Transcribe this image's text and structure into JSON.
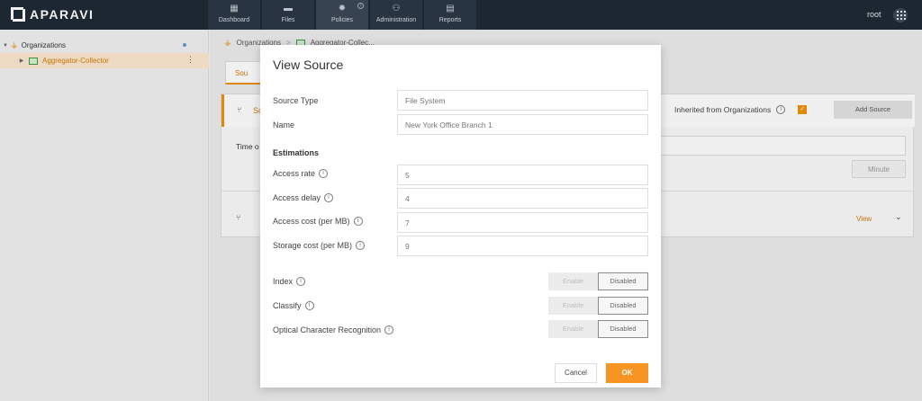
{
  "app": {
    "logo_text": "APARAVI"
  },
  "nav": {
    "items": [
      {
        "label": "Dashboard",
        "icon": "dashboard-icon"
      },
      {
        "label": "Files",
        "icon": "folder-icon"
      },
      {
        "label": "Policies",
        "icon": "gear-icon"
      },
      {
        "label": "Administration",
        "icon": "users-icon"
      },
      {
        "label": "Reports",
        "icon": "report-icon"
      }
    ],
    "active": "Policies",
    "policies_badge": "i"
  },
  "user": {
    "name": "root"
  },
  "tree": {
    "items": [
      {
        "label": "Organizations",
        "level": 0,
        "expanded": true
      },
      {
        "label": "Aggregator-Collector",
        "level": 1,
        "selected": true
      }
    ]
  },
  "breadcrumb": {
    "items": [
      "Organizations",
      "Aggregator-Collec..."
    ],
    "separator": ">"
  },
  "background": {
    "tab_label": "Sou",
    "panel_label": "So",
    "inherited_label": "Inherited from Organizations",
    "add_source_label": "Add Source",
    "time_label": "Time o",
    "minute_label": "Minute",
    "view_label": "View"
  },
  "modal": {
    "title": "View Source",
    "source_type": {
      "label": "Source Type",
      "placeholder": "File System"
    },
    "name": {
      "label": "Name",
      "placeholder": "New York Office Branch 1"
    },
    "estimations_heading": "Estimations",
    "access_rate": {
      "label": "Access rate",
      "placeholder": "5"
    },
    "access_delay": {
      "label": "Access delay",
      "placeholder": "4"
    },
    "access_cost": {
      "label": "Access cost (per MB)",
      "placeholder": "7"
    },
    "storage_cost": {
      "label": "Storage cost (per MB)",
      "placeholder": "9"
    },
    "index": {
      "label": "Index",
      "enable": "Enable",
      "disabled": "Disabled",
      "state": "Disabled"
    },
    "classify": {
      "label": "Classify",
      "enable": "Enable",
      "disabled": "Disabled",
      "state": "Disabled"
    },
    "ocr": {
      "label": "Optical Character Recognition",
      "enable": "Enable",
      "disabled": "Disabled",
      "state": "Disabled"
    },
    "cancel_label": "Cancel",
    "ok_label": "OK"
  },
  "colors": {
    "accent": "#f79422",
    "topbar": "#1e2a36",
    "selection": "#fbe9cf"
  }
}
